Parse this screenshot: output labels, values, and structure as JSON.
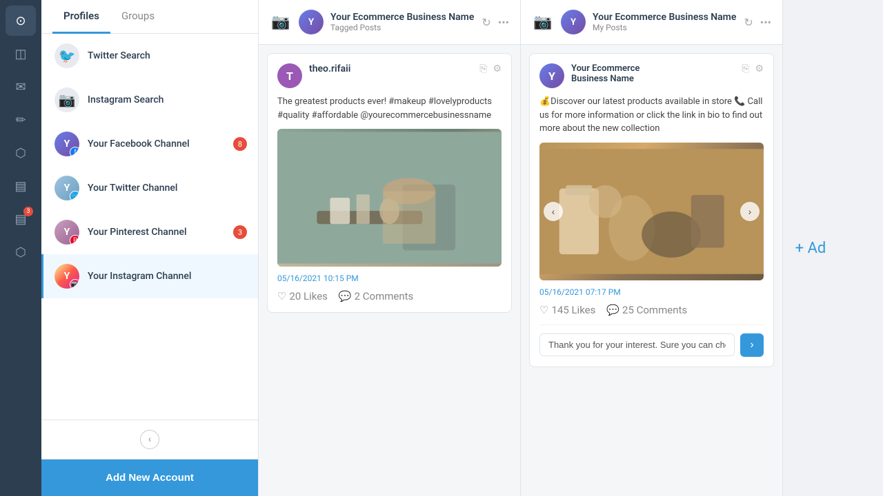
{
  "farNav": {
    "items": [
      {
        "name": "dashboard",
        "icon": "⊙",
        "active": true
      },
      {
        "name": "analytics",
        "icon": "◫"
      },
      {
        "name": "messages",
        "icon": "✉"
      },
      {
        "name": "compose",
        "icon": "✏"
      },
      {
        "name": "network",
        "icon": "⬡"
      },
      {
        "name": "reports",
        "icon": "▤"
      },
      {
        "name": "content",
        "icon": "▤"
      },
      {
        "name": "tools",
        "icon": "⬡"
      }
    ]
  },
  "sidebar": {
    "profilesTab": "Profiles",
    "groupsTab": "Groups",
    "addNewAccount": "Add New Account",
    "items": [
      {
        "id": "twitter-search",
        "label": "Twitter Search",
        "type": "search",
        "icon": "🔍",
        "social": "twitter"
      },
      {
        "id": "instagram-search",
        "label": "Instagram Search",
        "type": "search",
        "icon": "🔍",
        "social": "instagram"
      },
      {
        "id": "facebook-channel",
        "label": "Your Facebook Channel",
        "type": "channel",
        "social": "facebook",
        "badge": "8"
      },
      {
        "id": "twitter-channel",
        "label": "Your Twitter Channel",
        "type": "channel",
        "social": "twitter"
      },
      {
        "id": "pinterest-channel",
        "label": "Your Pinterest Channel",
        "type": "channel",
        "social": "pinterest",
        "badge": "3"
      },
      {
        "id": "instagram-channel",
        "label": "Your Instagram Channel",
        "type": "channel",
        "social": "instagram",
        "active": true
      }
    ]
  },
  "columns": [
    {
      "id": "col1",
      "header": {
        "igIcon": "📷",
        "title": "Your Ecommerce Business Name",
        "subtitle": "Tagged Posts"
      },
      "posts": [
        {
          "id": "post1",
          "avatarLetter": "T",
          "avatarColor": "#9b59b6",
          "username": "theo.rifaii",
          "body": "The greatest products ever! #makeup #lovelyproducts #quality #affordable @yourecommercebusinessname",
          "imageType": "tray",
          "timestamp": "05/16/2021 10:15 PM",
          "likes": "20 Likes",
          "comments": "2 Comments"
        }
      ]
    },
    {
      "id": "col2",
      "header": {
        "igIcon": "📷",
        "title": "Your Ecommerce Business Name",
        "subtitle": "My Posts"
      },
      "posts": [
        {
          "id": "post2",
          "avatarLetter": "Y",
          "avatarColor": "#667eea",
          "username": "Your Ecommerce\nBusiness Name",
          "body": "💰Discover our latest products available in store 📞 Call us for more information or click the link in bio to find out more about the new collection",
          "imageType": "beauty",
          "timestamp": "05/16/2021 07:17 PM",
          "likes": "145 Likes",
          "comments": "25 Comments",
          "replyPlaceholder": "Thank you for your interest. Sure you can chec..."
        }
      ]
    }
  ],
  "addColumnLabel": "+ Ad"
}
